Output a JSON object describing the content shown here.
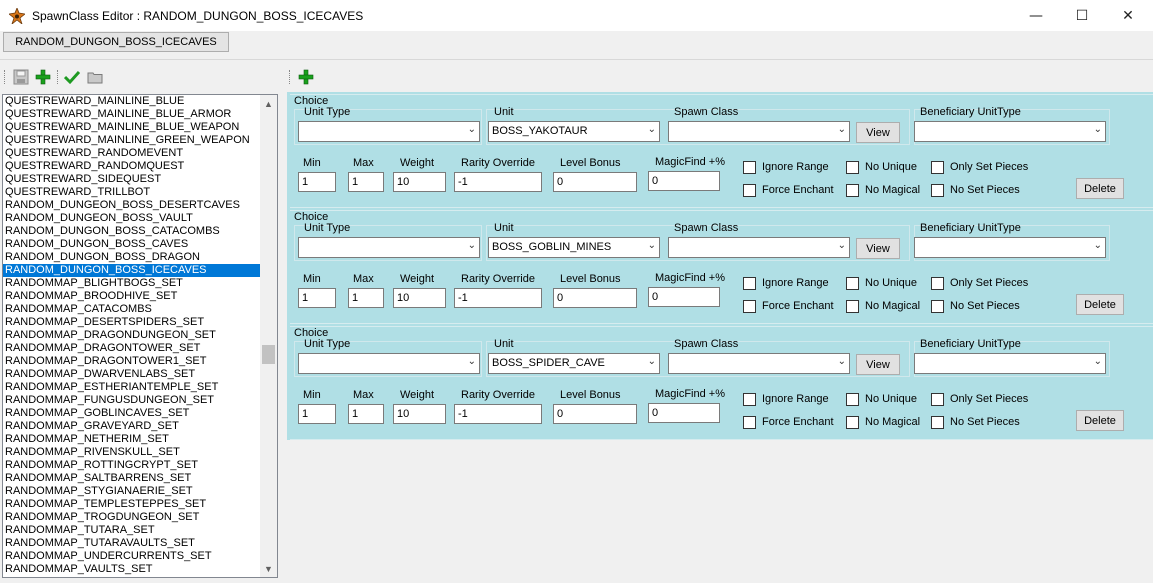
{
  "window": {
    "title": "SpawnClass Editor : RANDOM_DUNGON_BOSS_ICECAVES",
    "minimize": "—",
    "maximize": "☐",
    "close": "✕"
  },
  "tab": {
    "label": "RANDOM_DUNGON_BOSS_ICECAVES"
  },
  "left_toolbar": {
    "icons": [
      "save-icon",
      "add-icon",
      "checkmark-icon",
      "folder-icon"
    ]
  },
  "right_toolbar": {
    "icons": [
      "add-icon"
    ]
  },
  "list": {
    "selected": "RANDOM_DUNGON_BOSS_ICECAVES",
    "items": [
      "QUESTREWARD_MAINLINE_BLUE",
      "QUESTREWARD_MAINLINE_BLUE_ARMOR",
      "QUESTREWARD_MAINLINE_BLUE_WEAPON",
      "QUESTREWARD_MAINLINE_GREEN_WEAPON",
      "QUESTREWARD_RANDOMEVENT",
      "QUESTREWARD_RANDOMQUEST",
      "QUESTREWARD_SIDEQUEST",
      "QUESTREWARD_TRILLBOT",
      "RANDOM_DUNGEON_BOSS_DESERTCAVES",
      "RANDOM_DUNGEON_BOSS_VAULT",
      "RANDOM_DUNGON_BOSS_CATACOMBS",
      "RANDOM_DUNGON_BOSS_CAVES",
      "RANDOM_DUNGON_BOSS_DRAGON",
      "RANDOM_DUNGON_BOSS_ICECAVES",
      "RANDOMMAP_BLIGHTBOGS_SET",
      "RANDOMMAP_BROODHIVE_SET",
      "RANDOMMAP_CATACOMBS",
      "RANDOMMAP_DESERTSPIDERS_SET",
      "RANDOMMAP_DRAGONDUNGEON_SET",
      "RANDOMMAP_DRAGONTOWER_SET",
      "RANDOMMAP_DRAGONTOWER1_SET",
      "RANDOMMAP_DWARVENLABS_SET",
      "RANDOMMAP_ESTHERIANTEMPLE_SET",
      "RANDOMMAP_FUNGUSDUNGEON_SET",
      "RANDOMMAP_GOBLINCAVES_SET",
      "RANDOMMAP_GRAVEYARD_SET",
      "RANDOMMAP_NETHERIM_SET",
      "RANDOMMAP_RIVENSKULL_SET",
      "RANDOMMAP_ROTTINGCRYPT_SET",
      "RANDOMMAP_SALTBARRENS_SET",
      "RANDOMMAP_STYGIANAERIE_SET",
      "RANDOMMAP_TEMPLESTEPPES_SET",
      "RANDOMMAP_TROGDUNGEON_SET",
      "RANDOMMAP_TUTARA_SET",
      "RANDOMMAP_TUTARAVAULTS_SET",
      "RANDOMMAP_UNDERCURRENTS_SET",
      "RANDOMMAP_VAULTS_SET"
    ]
  },
  "labels": {
    "choice": "Choice",
    "unit_type": "Unit Type",
    "unit": "Unit",
    "spawn_class": "Spawn Class",
    "beneficiary": "Beneficiary UnitType",
    "min": "Min",
    "max": "Max",
    "weight": "Weight",
    "rarity": "Rarity Override",
    "level_bonus": "Level Bonus",
    "magic_find": "MagicFind +%",
    "view": "View",
    "delete": "Delete",
    "ignore_range": "Ignore Range",
    "force_enchant": "Force Enchant",
    "no_unique": "No Unique",
    "no_magical": "No Magical",
    "only_set_pieces": "Only Set Pieces",
    "no_set_pieces": "No Set Pieces"
  },
  "choices": [
    {
      "unit_type": "",
      "unit": "BOSS_YAKOTAUR",
      "spawn_class": "",
      "beneficiary": "",
      "min": "1",
      "max": "1",
      "weight": "10",
      "rarity": "-1",
      "level_bonus": "0",
      "magic_find": "0",
      "ignore_range": false,
      "force_enchant": false,
      "no_unique": false,
      "no_magical": false,
      "only_set_pieces": false,
      "no_set_pieces": false
    },
    {
      "unit_type": "",
      "unit": "BOSS_GOBLIN_MINES",
      "spawn_class": "",
      "beneficiary": "",
      "min": "1",
      "max": "1",
      "weight": "10",
      "rarity": "-1",
      "level_bonus": "0",
      "magic_find": "0",
      "ignore_range": false,
      "force_enchant": false,
      "no_unique": false,
      "no_magical": false,
      "only_set_pieces": false,
      "no_set_pieces": false
    },
    {
      "unit_type": "",
      "unit": "BOSS_SPIDER_CAVE",
      "spawn_class": "",
      "beneficiary": "",
      "min": "1",
      "max": "1",
      "weight": "10",
      "rarity": "-1",
      "level_bonus": "0",
      "magic_find": "0",
      "ignore_range": false,
      "force_enchant": false,
      "no_unique": false,
      "no_magical": false,
      "only_set_pieces": false,
      "no_set_pieces": false
    }
  ]
}
